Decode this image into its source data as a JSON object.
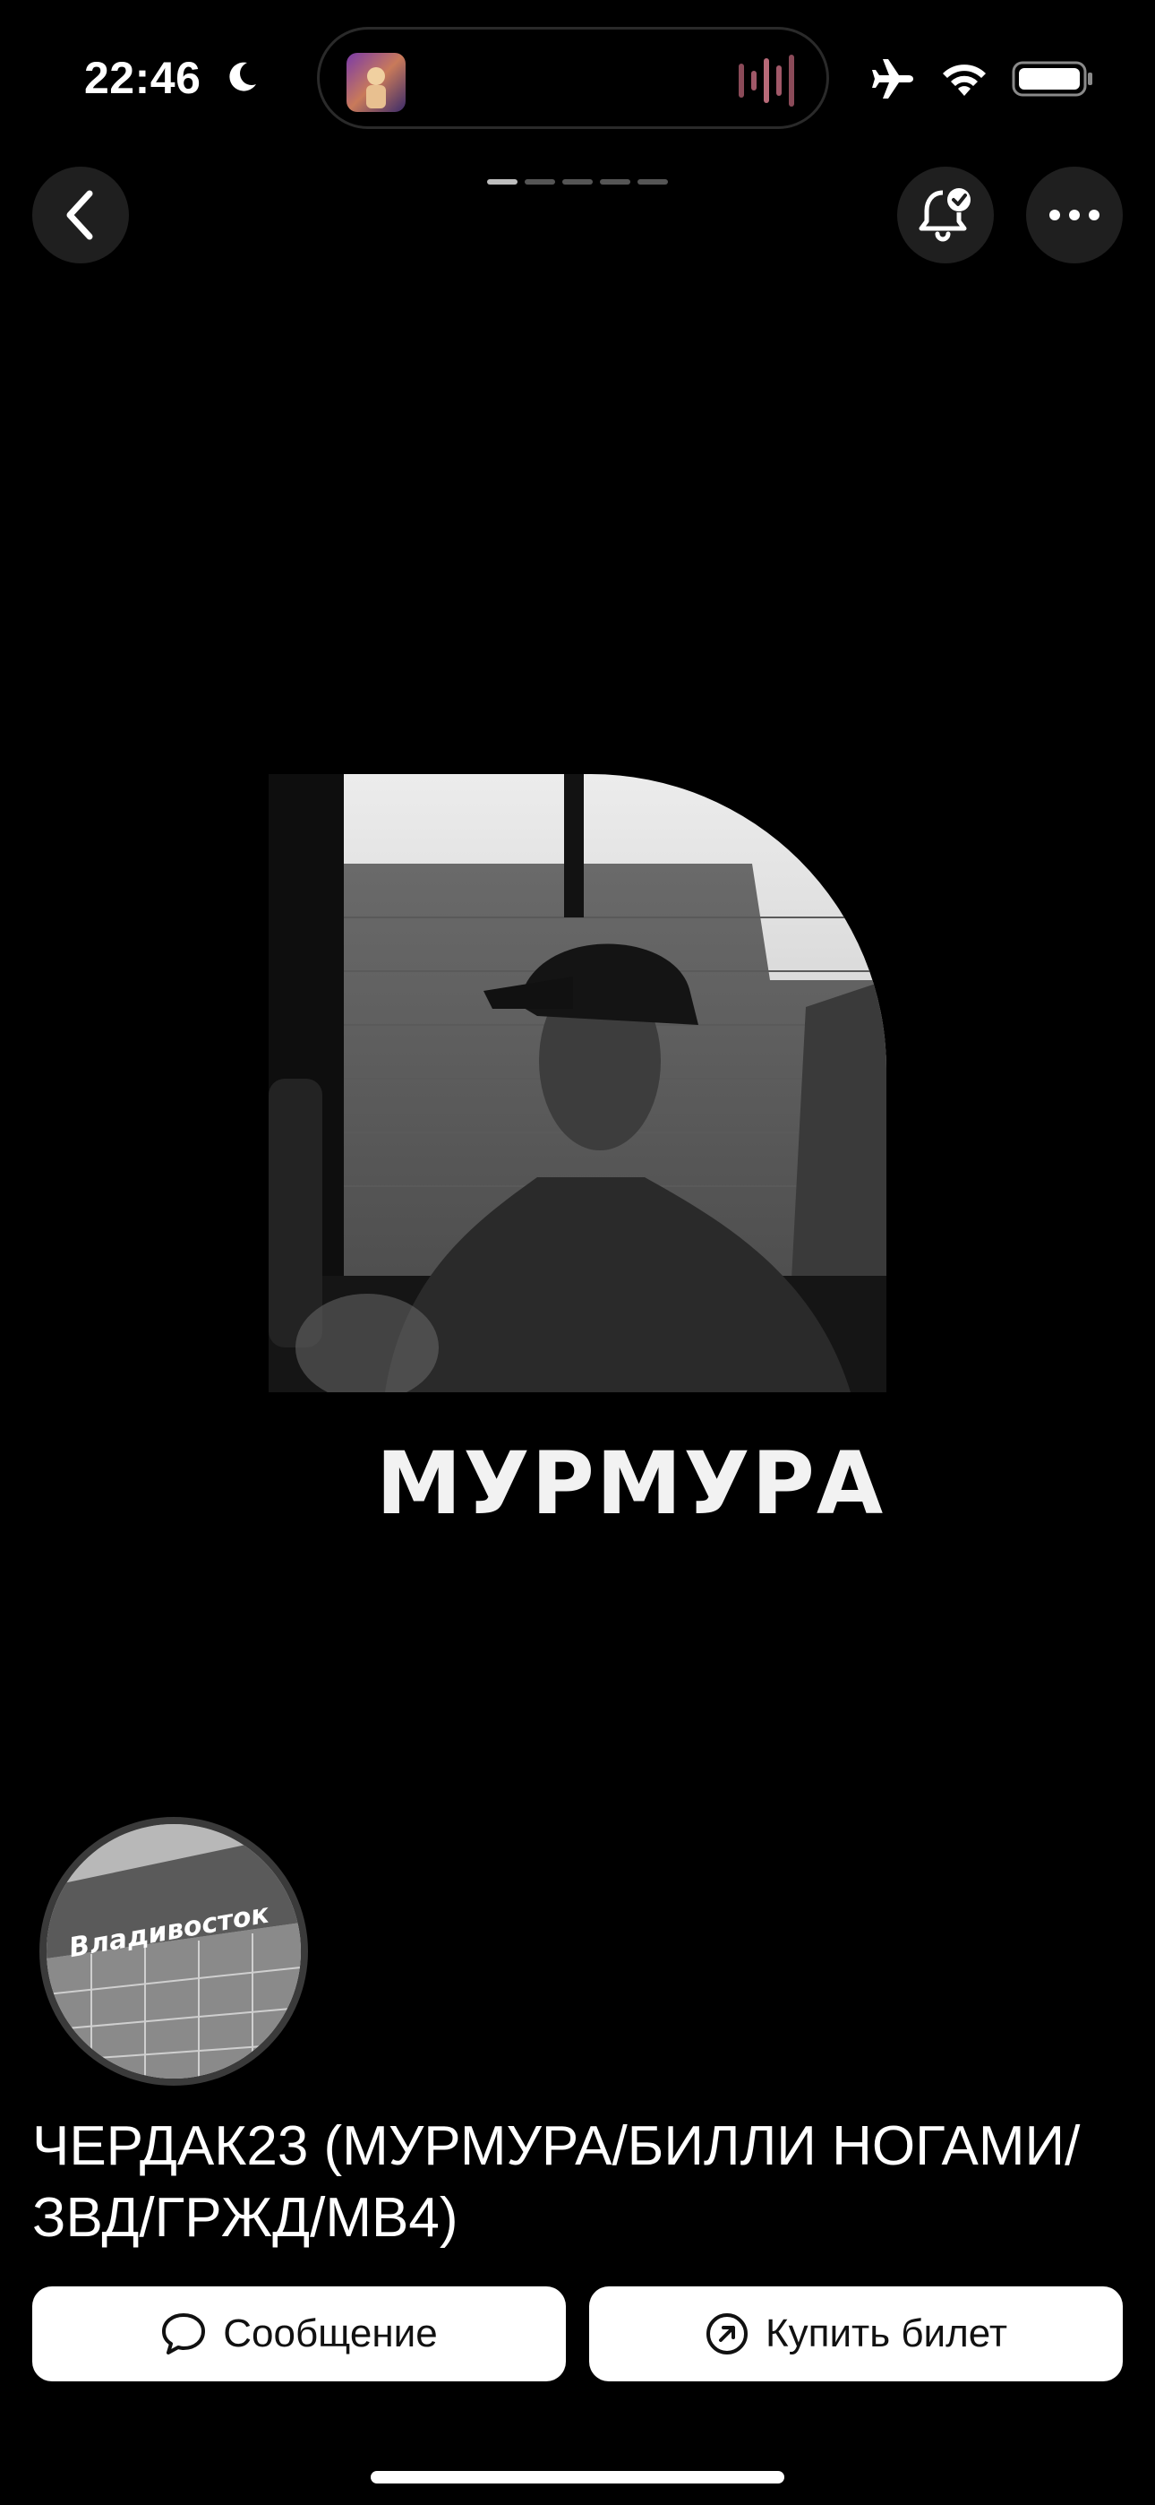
{
  "status_bar": {
    "time": "22:46",
    "icons": [
      "moon-icon",
      "airplane-icon",
      "wifi-icon",
      "battery-icon"
    ]
  },
  "dynamic_island": {
    "icons": [
      "now-playing-artwork",
      "audio-wave-icon"
    ]
  },
  "header": {
    "icons": [
      "chevron-left-icon",
      "bell-check-icon",
      "ellipsis-icon"
    ],
    "pager": {
      "count": 5,
      "active_index": 0
    }
  },
  "cover": {
    "title": "МУРМУРА"
  },
  "channel": {
    "avatar_text": "Владивосток",
    "title": "ЧЕРДАК23 (МУРМУРА/БИЛЛИ НОГАМИ/ЗВД/ГРЖД/МВ4)"
  },
  "actions": {
    "message_label": "Сообщение",
    "ticket_label": "Купить билет"
  },
  "colors": {
    "background": "#000000",
    "button_bg": "#ffffff",
    "circle_bg": "#1f1f1f"
  }
}
